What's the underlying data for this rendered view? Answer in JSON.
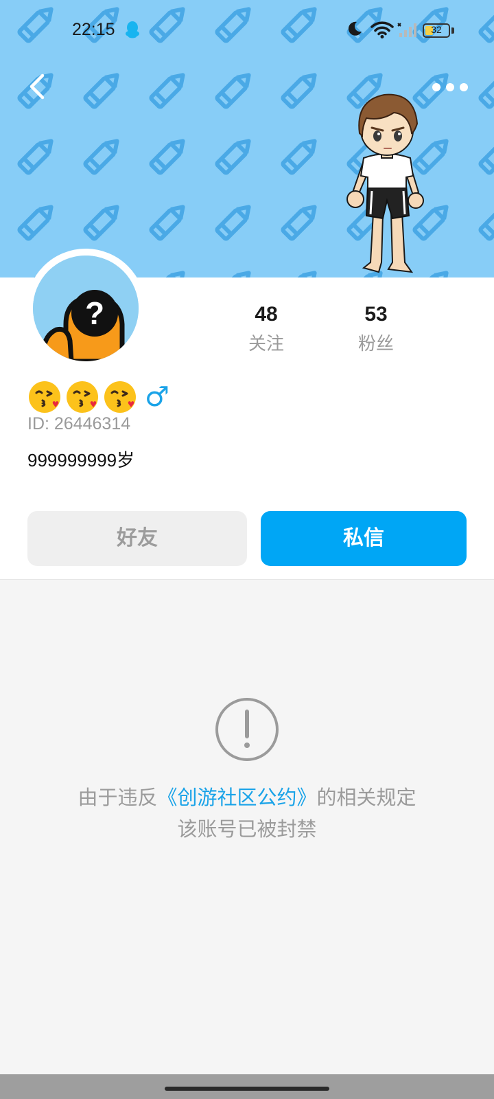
{
  "status_bar": {
    "time": "22:15",
    "battery_level": "32",
    "icons": [
      "qq-icon",
      "moon-icon",
      "wifi-icon",
      "signal-icon",
      "battery-icon"
    ]
  },
  "header": {
    "back_icon": "chevron-left-icon",
    "more_icon": "more-dots-icon",
    "background_color": "#87cdf7"
  },
  "profile": {
    "avatar_icon": "question-mark-avatar",
    "stats": [
      {
        "value": "48",
        "label": "关注"
      },
      {
        "value": "53",
        "label": "粉丝"
      }
    ],
    "nickname_emojis": [
      "😘",
      "😘",
      "😘"
    ],
    "gender_symbol": "♂",
    "user_id": "ID: 26446314",
    "age": "999999999岁"
  },
  "actions": {
    "friend_label": "好友",
    "message_label": "私信"
  },
  "notice": {
    "line1_prefix": "由于违反",
    "link_text": "《创游社区公约》",
    "line1_suffix": "的相关规定",
    "line2": "该账号已被封禁"
  },
  "colors": {
    "accent": "#00a6f5",
    "link": "#1aa3e8",
    "muted_text": "#9b9b9b"
  }
}
